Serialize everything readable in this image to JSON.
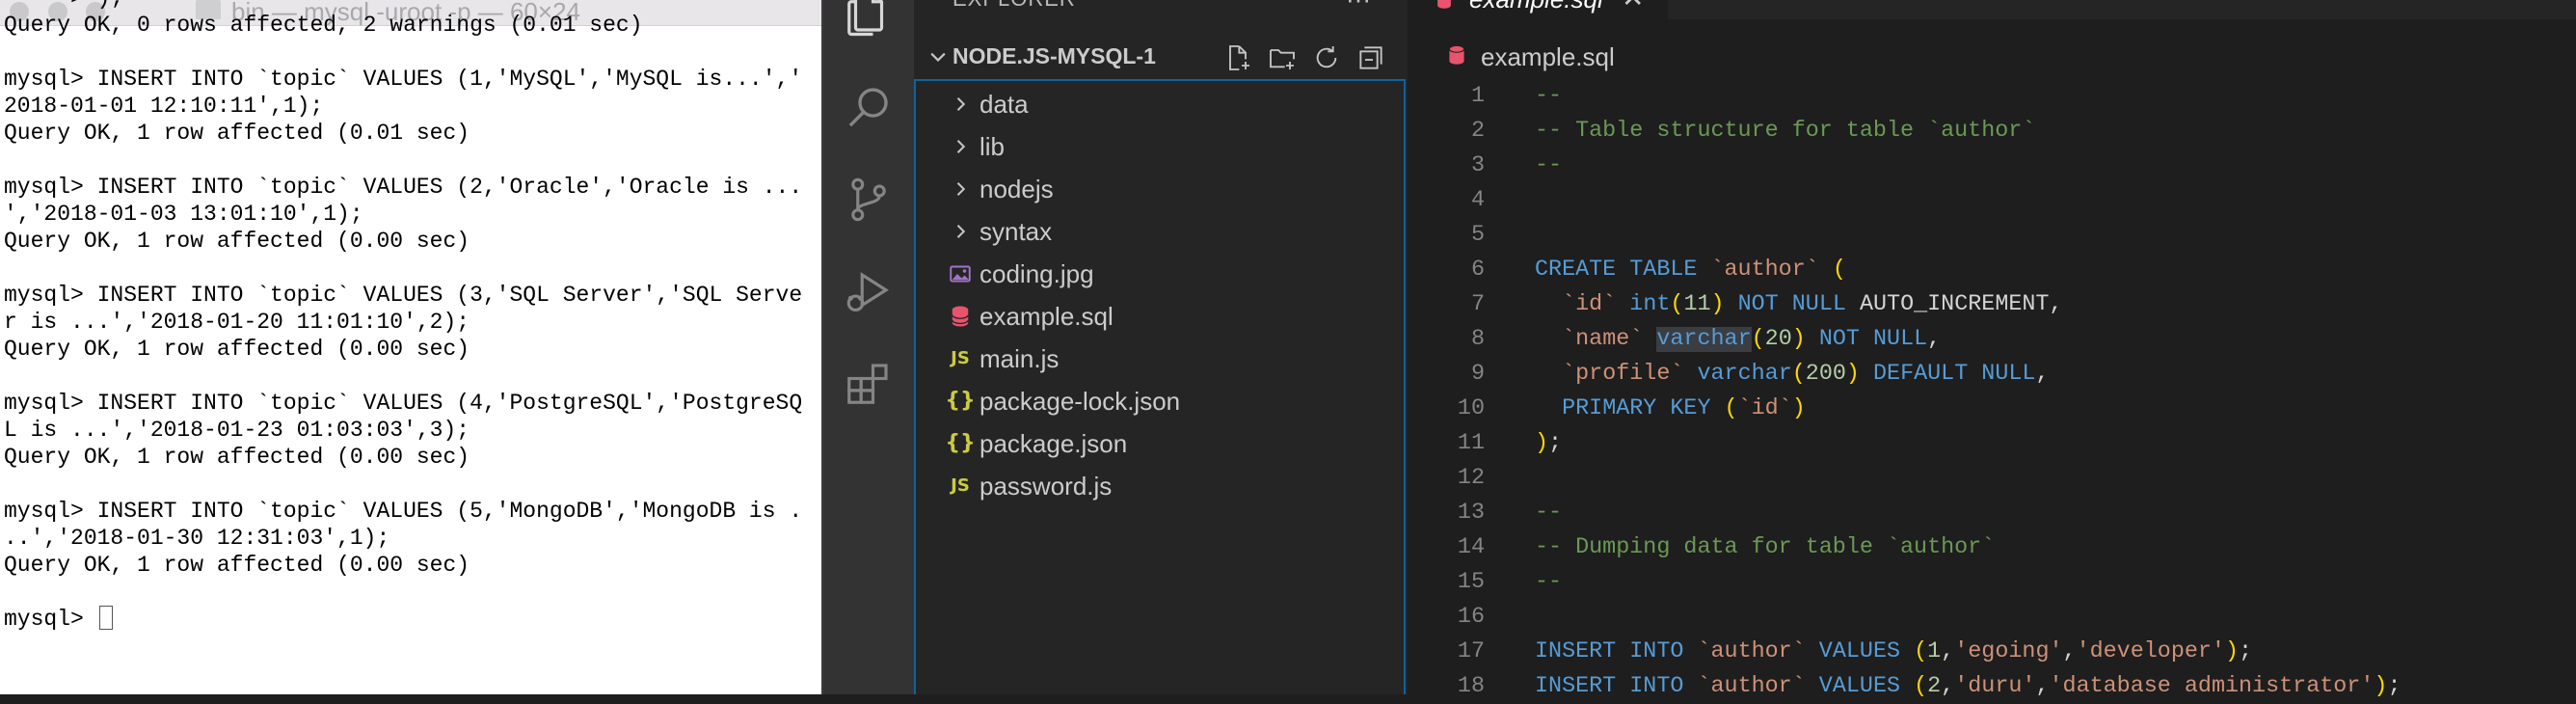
{
  "terminal": {
    "title": "bin — mysql -uroot -p — 60×24",
    "lines": [
      "    -> );",
      "Query OK, 0 rows affected, 2 warnings (0.01 sec)",
      "",
      "mysql> INSERT INTO `topic` VALUES (1,'MySQL','MySQL is...','",
      "2018-01-01 12:10:11',1);",
      "Query OK, 1 row affected (0.01 sec)",
      "",
      "mysql> INSERT INTO `topic` VALUES (2,'Oracle','Oracle is ...",
      "','2018-01-03 13:01:10',1);",
      "Query OK, 1 row affected (0.00 sec)",
      "",
      "mysql> INSERT INTO `topic` VALUES (3,'SQL Server','SQL Serve",
      "r is ...','2018-01-20 11:01:10',2);",
      "Query OK, 1 row affected (0.00 sec)",
      "",
      "mysql> INSERT INTO `topic` VALUES (4,'PostgreSQL','PostgreSQ",
      "L is ...','2018-01-23 01:03:03',3);",
      "Query OK, 1 row affected (0.00 sec)",
      "",
      "mysql> INSERT INTO `topic` VALUES (5,'MongoDB','MongoDB is .",
      "..','2018-01-30 12:31:03',1);",
      "Query OK, 1 row affected (0.00 sec)",
      ""
    ],
    "prompt": "mysql> "
  },
  "activity_bar": {
    "icons": [
      "files-icon",
      "search-icon",
      "source-control-icon",
      "run-debug-icon",
      "extensions-icon"
    ]
  },
  "sidebar": {
    "header": "EXPLORER",
    "more": "···",
    "project_name": "NODE.JS-MYSQL-1",
    "actions": [
      "new-file-icon",
      "new-folder-icon",
      "refresh-icon",
      "collapse-all-icon"
    ],
    "items": [
      {
        "label": "data",
        "kind": "folder",
        "icon": "chevron-right-icon"
      },
      {
        "label": "lib",
        "kind": "folder",
        "icon": "chevron-right-icon"
      },
      {
        "label": "nodejs",
        "kind": "folder",
        "icon": "chevron-right-icon"
      },
      {
        "label": "syntax",
        "kind": "folder",
        "icon": "chevron-right-icon"
      },
      {
        "label": "coding.jpg",
        "kind": "image",
        "icon": "image-file-icon"
      },
      {
        "label": "example.sql",
        "kind": "sql",
        "icon": "database-file-icon"
      },
      {
        "label": "main.js",
        "kind": "js",
        "icon": "js-file-icon",
        "glyph": "JS"
      },
      {
        "label": "package-lock.json",
        "kind": "json",
        "icon": "json-file-icon",
        "glyph": "{}"
      },
      {
        "label": "package.json",
        "kind": "json",
        "icon": "json-file-icon",
        "glyph": "{}"
      },
      {
        "label": "password.js",
        "kind": "js",
        "icon": "js-file-icon",
        "glyph": "JS"
      }
    ]
  },
  "editor": {
    "tab_label": "example.sql",
    "tab_close": "✕",
    "breadcrumb": "example.sql",
    "colors": {
      "comment": "#6a9955",
      "keyword": "#569cd6",
      "string": "#ce9178",
      "number": "#b5cea8",
      "paren": "#ffd700",
      "text": "#d4d4d4"
    },
    "lines": [
      {
        "n": "1",
        "tokens": [
          [
            "comment",
            "--"
          ]
        ]
      },
      {
        "n": "2",
        "tokens": [
          [
            "comment",
            "-- Table structure for table `author`"
          ]
        ]
      },
      {
        "n": "3",
        "tokens": [
          [
            "comment",
            "--"
          ]
        ]
      },
      {
        "n": "4",
        "tokens": []
      },
      {
        "n": "5",
        "tokens": []
      },
      {
        "n": "6",
        "tokens": [
          [
            "keyword",
            "CREATE TABLE "
          ],
          [
            "string",
            "`author`"
          ],
          [
            "plain",
            " "
          ],
          [
            "paren",
            "("
          ]
        ]
      },
      {
        "n": "7",
        "tokens": [
          [
            "plain",
            "  "
          ],
          [
            "string",
            "`id`"
          ],
          [
            "plain",
            " "
          ],
          [
            "keyword",
            "int"
          ],
          [
            "paren",
            "("
          ],
          [
            "number",
            "11"
          ],
          [
            "paren",
            ")"
          ],
          [
            "plain",
            " "
          ],
          [
            "keyword",
            "NOT NULL"
          ],
          [
            "plain",
            " AUTO_INCREMENT,"
          ]
        ]
      },
      {
        "n": "8",
        "tokens": [
          [
            "plain",
            "  "
          ],
          [
            "string",
            "`name`"
          ],
          [
            "plain",
            " "
          ],
          [
            "keyword-hl",
            "varchar"
          ],
          [
            "paren",
            "("
          ],
          [
            "number",
            "20"
          ],
          [
            "paren",
            ")"
          ],
          [
            "plain",
            " "
          ],
          [
            "keyword",
            "NOT NULL"
          ],
          [
            "plain",
            ","
          ]
        ]
      },
      {
        "n": "9",
        "tokens": [
          [
            "plain",
            "  "
          ],
          [
            "string",
            "`profile`"
          ],
          [
            "plain",
            " "
          ],
          [
            "keyword",
            "varchar"
          ],
          [
            "paren",
            "("
          ],
          [
            "number",
            "200"
          ],
          [
            "paren",
            ")"
          ],
          [
            "plain",
            " "
          ],
          [
            "keyword",
            "DEFAULT NULL"
          ],
          [
            "plain",
            ","
          ]
        ]
      },
      {
        "n": "10",
        "tokens": [
          [
            "plain",
            "  "
          ],
          [
            "keyword",
            "PRIMARY KEY"
          ],
          [
            "plain",
            " "
          ],
          [
            "paren",
            "("
          ],
          [
            "string",
            "`id`"
          ],
          [
            "paren",
            ")"
          ]
        ]
      },
      {
        "n": "11",
        "tokens": [
          [
            "paren",
            ")"
          ],
          [
            "plain",
            ";"
          ]
        ]
      },
      {
        "n": "12",
        "tokens": []
      },
      {
        "n": "13",
        "tokens": [
          [
            "comment",
            "--"
          ]
        ]
      },
      {
        "n": "14",
        "tokens": [
          [
            "comment",
            "-- Dumping data for table `author`"
          ]
        ]
      },
      {
        "n": "15",
        "tokens": [
          [
            "comment",
            "--"
          ]
        ]
      },
      {
        "n": "16",
        "tokens": []
      },
      {
        "n": "17",
        "tokens": [
          [
            "keyword",
            "INSERT INTO"
          ],
          [
            "plain",
            " "
          ],
          [
            "string",
            "`author`"
          ],
          [
            "plain",
            " "
          ],
          [
            "keyword",
            "VALUES"
          ],
          [
            "plain",
            " "
          ],
          [
            "paren",
            "("
          ],
          [
            "number",
            "1"
          ],
          [
            "plain",
            ","
          ],
          [
            "string",
            "'egoing'"
          ],
          [
            "plain",
            ","
          ],
          [
            "string",
            "'developer'"
          ],
          [
            "paren",
            ")"
          ],
          [
            "plain",
            ";"
          ]
        ]
      },
      {
        "n": "18",
        "tokens": [
          [
            "keyword",
            "INSERT INTO"
          ],
          [
            "plain",
            " "
          ],
          [
            "string",
            "`author`"
          ],
          [
            "plain",
            " "
          ],
          [
            "keyword",
            "VALUES"
          ],
          [
            "plain",
            " "
          ],
          [
            "paren",
            "("
          ],
          [
            "number",
            "2"
          ],
          [
            "plain",
            ","
          ],
          [
            "string",
            "'duru'"
          ],
          [
            "plain",
            ","
          ],
          [
            "string",
            "'database administrator'"
          ],
          [
            "paren",
            ")"
          ],
          [
            "plain",
            ";"
          ]
        ]
      }
    ]
  }
}
